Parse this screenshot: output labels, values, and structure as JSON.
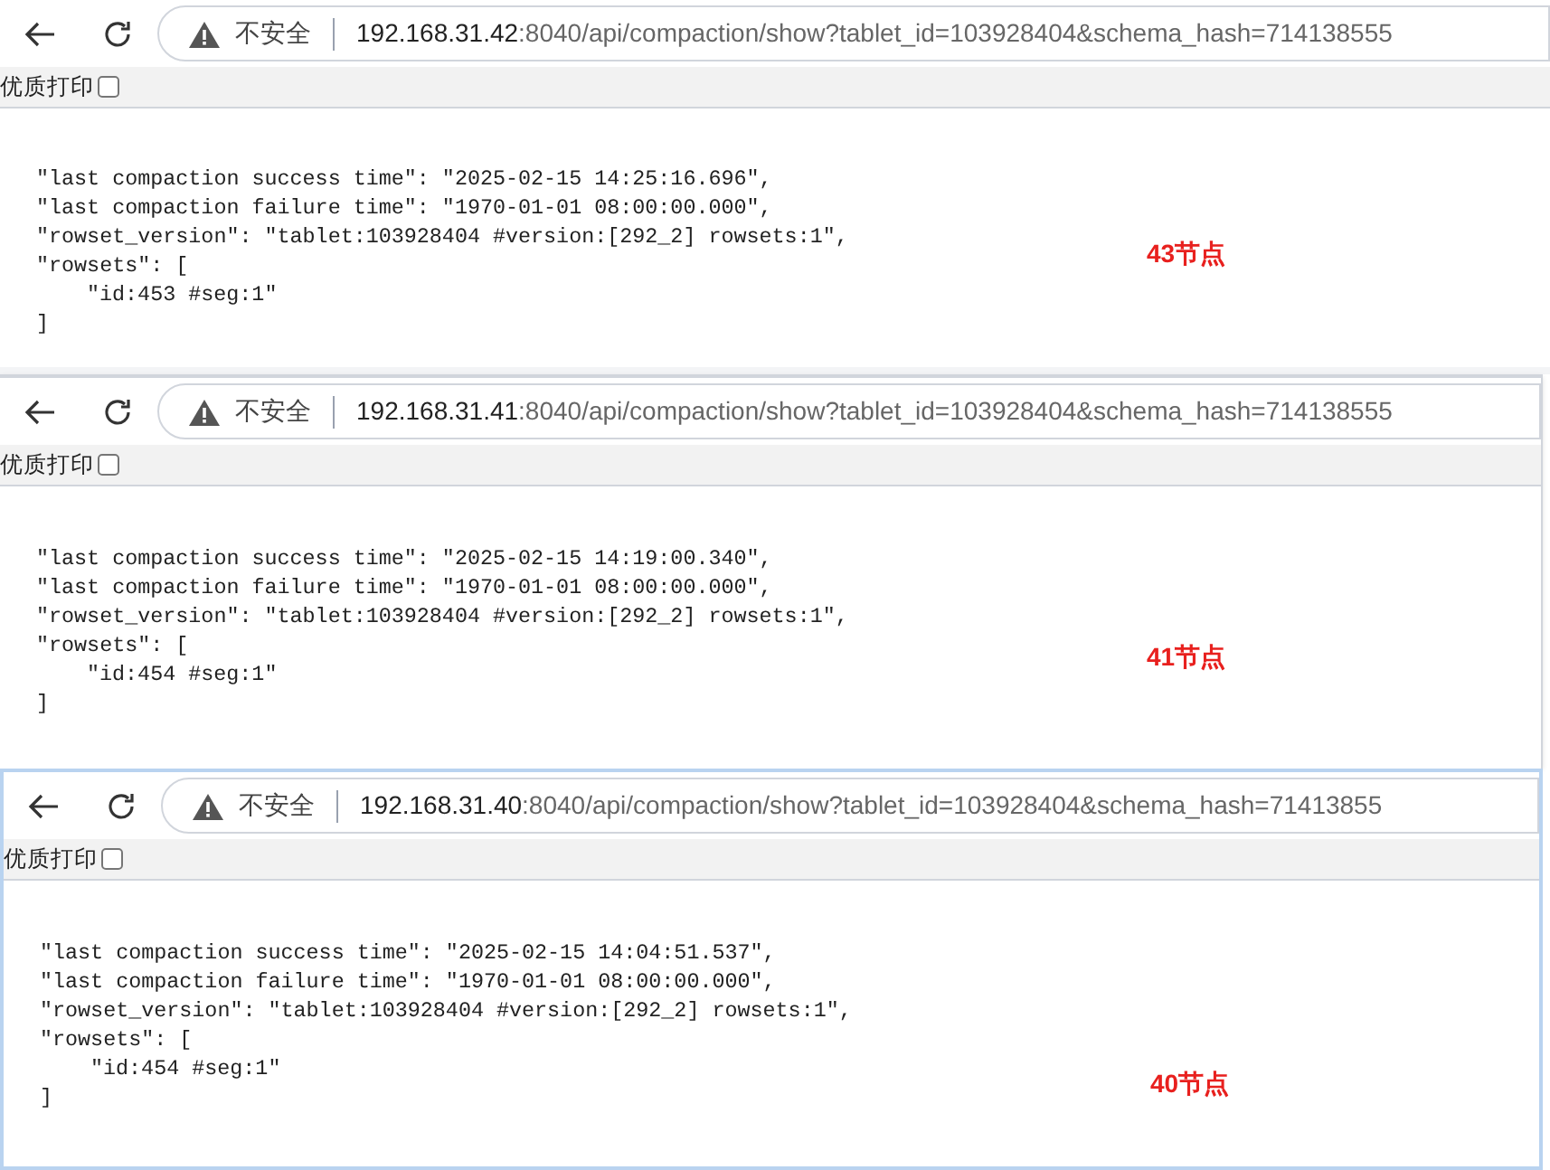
{
  "panels": [
    {
      "address": {
        "warning": "不安全",
        "host": "192.168.31.42",
        "path": ":8040/api/compaction/show?tablet_id=103928404&schema_hash=714138555"
      },
      "print": {
        "label": "优质打印",
        "checked": false
      },
      "lines": [
        {
          "text": "\"last compaction success time\": \"2025-02-15 14:25:16.696\","
        },
        {
          "text": "\"last compaction failure time\": \"1970-01-01 08:00:00.000\","
        },
        {
          "text": "\"rowset_version\": \"tablet:103928404 #version:[292_2] rowsets:1\","
        },
        {
          "text": "\"rowsets\": [",
          "children": [
            {
              "text": "\"id:453 #seg:1\""
            }
          ]
        },
        {
          "text": "]"
        }
      ],
      "note": "43节点"
    },
    {
      "address": {
        "warning": "不安全",
        "host": "192.168.31.41",
        "path": ":8040/api/compaction/show?tablet_id=103928404&schema_hash=714138555"
      },
      "print": {
        "label": "优质打印",
        "checked": false
      },
      "lines": [
        {
          "text": "\"last compaction success time\": \"2025-02-15 14:19:00.340\","
        },
        {
          "text": "\"last compaction failure time\": \"1970-01-01 08:00:00.000\","
        },
        {
          "text": "\"rowset_version\": \"tablet:103928404 #version:[292_2] rowsets:1\","
        },
        {
          "text": "\"rowsets\": [",
          "children": [
            {
              "text": "\"id:454 #seg:1\""
            }
          ]
        },
        {
          "text": "]"
        }
      ],
      "note": "41节点"
    },
    {
      "address": {
        "warning": "不安全",
        "host": "192.168.31.40",
        "path": ":8040/api/compaction/show?tablet_id=103928404&schema_hash=71413855"
      },
      "print": {
        "label": "优质打印",
        "checked": false
      },
      "lines": [
        {
          "text": "\"last compaction success time\": \"2025-02-15 14:04:51.537\","
        },
        {
          "text": "\"last compaction failure time\": \"1970-01-01 08:00:00.000\","
        },
        {
          "text": "\"rowset_version\": \"tablet:103928404 #version:[292_2] rowsets:1\","
        },
        {
          "text": "\"rowsets\": [",
          "children": [
            {
              "text": "\"id:454 #seg:1\""
            }
          ]
        },
        {
          "text": "]"
        }
      ],
      "note": "40节点"
    }
  ]
}
